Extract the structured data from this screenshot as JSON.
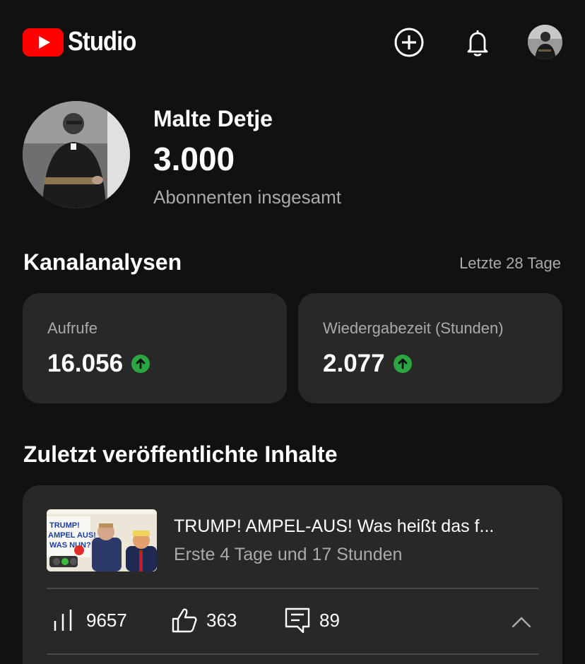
{
  "header": {
    "logo_text": "Studio",
    "icons": [
      "create-icon",
      "notifications-bell-icon",
      "account-avatar"
    ]
  },
  "profile": {
    "channel_name": "Malte Detje",
    "subscriber_count": "3.000",
    "subscriber_label": "Abonnenten insgesamt"
  },
  "analytics": {
    "title": "Kanalanalysen",
    "period": "Letzte 28 Tage",
    "cards": [
      {
        "label": "Aufrufe",
        "value": "16.056",
        "trend": "up"
      },
      {
        "label": "Wiedergabezeit (Stunden)",
        "value": "2.077",
        "trend": "up"
      }
    ]
  },
  "recent": {
    "title": "Zuletzt veröffentlichte Inhalte",
    "video": {
      "title": "TRUMP! AMPEL-AUS! Was heißt das f...",
      "subtitle": "Erste 4 Tage und 17 Stunden",
      "thumbnail_text": "TRUMP! AMPEL AUS! WAS NUN?",
      "views": "9657",
      "likes": "363",
      "comments": "89"
    }
  },
  "colors": {
    "background": "#111111",
    "card": "#282828",
    "brand_red": "#ff0000",
    "trend_up": "#2ba640",
    "secondary_text": "#aaaaaa"
  }
}
